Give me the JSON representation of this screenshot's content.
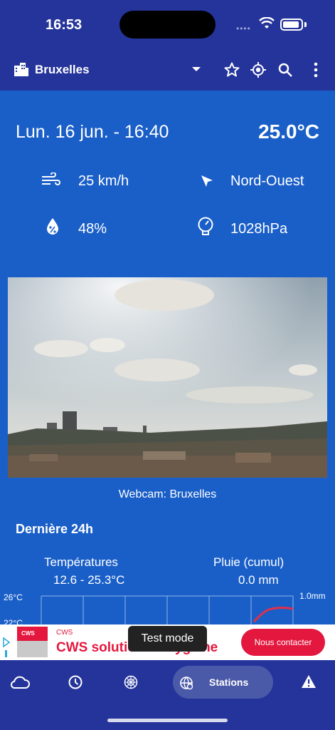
{
  "status_bar": {
    "time": "16:53"
  },
  "app_bar": {
    "city": "Bruxelles",
    "icons": [
      "city-icon",
      "dropdown-icon",
      "star-icon",
      "locate-icon",
      "search-icon",
      "more-icon"
    ]
  },
  "current": {
    "date_time": "Lun. 16 jun. - 16:40",
    "temperature": "25.0°C",
    "wind_speed": "25 km/h",
    "wind_direction": "Nord-Ouest",
    "humidity": "48%",
    "pressure": "1028hPa"
  },
  "webcam": {
    "caption": "Webcam: Bruxelles"
  },
  "last24": {
    "title": "Dernière 24h",
    "temp_label": "Températures",
    "temp_range": "12.6 - 25.3°C",
    "rain_label": "Pluie (cumul)",
    "rain_value": "0.0 mm"
  },
  "chart_data": {
    "type": "line",
    "y_left_ticks": [
      "26°C",
      "22°C"
    ],
    "y_right_ticks": [
      "1.0mm"
    ],
    "visible": "partial"
  },
  "ad": {
    "logo_text": "CWS",
    "brand": "CWS",
    "headline": "CWS solutions d'hygiène",
    "cta": "Nous contacter"
  },
  "toast": "Test mode",
  "nav": {
    "active_label": "Stations",
    "icons": [
      "cloud-icon",
      "clock-icon",
      "radar-icon",
      "stations-icon",
      "warning-icon"
    ]
  },
  "colors": {
    "primary_dark": "#24349a",
    "primary": "#1a5fc8",
    "ad_red": "#e4173e"
  }
}
